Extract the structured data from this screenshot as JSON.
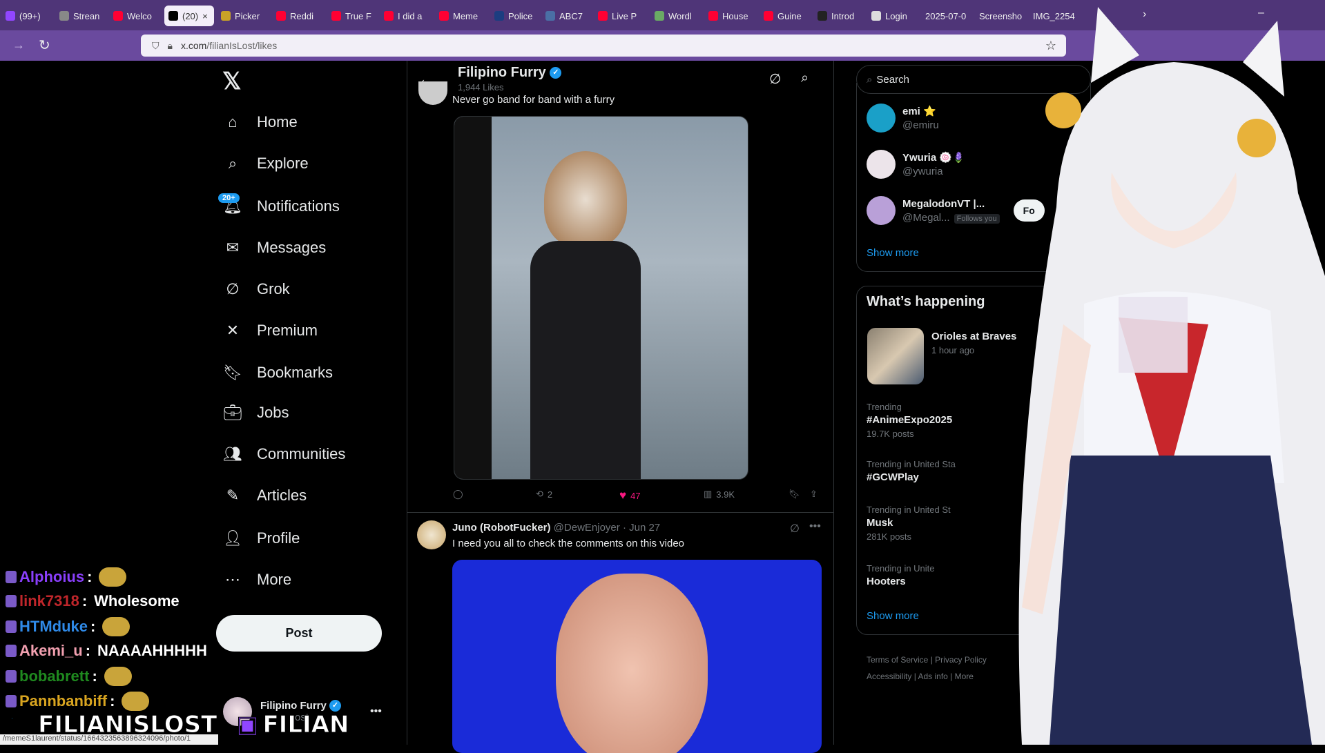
{
  "browser": {
    "tabs": [
      {
        "label": "(99+)",
        "color": "#9146ff"
      },
      {
        "label": "Strean",
        "color": "#888"
      },
      {
        "label": "Welco",
        "color": "#ff0033"
      },
      {
        "label": "(20)",
        "color": "#000",
        "active": true
      },
      {
        "label": "Picker",
        "color": "#c9a227"
      },
      {
        "label": "Reddi",
        "color": "#ff0033"
      },
      {
        "label": "True F",
        "color": "#ff0033"
      },
      {
        "label": "I did a",
        "color": "#ff0033"
      },
      {
        "label": "Meme",
        "color": "#ff0033"
      },
      {
        "label": "Police",
        "color": "#1c3d80"
      },
      {
        "label": "ABC7",
        "color": "#4a6fa5"
      },
      {
        "label": "Live P",
        "color": "#ff0033"
      },
      {
        "label": "Wordl",
        "color": "#6aaa64"
      },
      {
        "label": "House",
        "color": "#ff0033"
      },
      {
        "label": "Guine",
        "color": "#ff0033"
      },
      {
        "label": "Introd",
        "color": "#222"
      },
      {
        "label": "Login",
        "color": "#ddd"
      },
      {
        "label": "2025-07-0",
        "color": ""
      },
      {
        "label": "Screensho",
        "color": ""
      },
      {
        "label": "IMG_2254",
        "color": ""
      }
    ],
    "close": "×",
    "url_domain": "x.com",
    "url_path": "/filianIsLost/likes",
    "status_url": "/memeS1laurent/status/1664323563896324096/photo/1"
  },
  "nav": {
    "items": [
      {
        "label": "Home",
        "icon": "home-icon"
      },
      {
        "label": "Explore",
        "icon": "search-icon"
      },
      {
        "label": "Notifications",
        "icon": "bell-icon"
      },
      {
        "label": "Messages",
        "icon": "mail-icon"
      },
      {
        "label": "Grok",
        "icon": "grok-icon"
      },
      {
        "label": "Premium",
        "icon": "x-icon"
      },
      {
        "label": "Bookmarks",
        "icon": "bookmark-icon"
      },
      {
        "label": "Jobs",
        "icon": "briefcase-icon"
      },
      {
        "label": "Communities",
        "icon": "communities-icon"
      },
      {
        "label": "Articles",
        "icon": "articles-icon"
      },
      {
        "label": "Profile",
        "icon": "person-icon"
      },
      {
        "label": "More",
        "icon": "more-circle-icon"
      }
    ],
    "notif_badge": "20+",
    "post": "Post",
    "account_name": "Filipino Furry",
    "account_sub": "ost"
  },
  "header": {
    "title": "Filipino Furry",
    "count": "1,944 Likes"
  },
  "tweet1": {
    "text": "Never go band for band with a furry",
    "replies": "",
    "retweets": "2",
    "likes": "47",
    "views": "3.9K"
  },
  "tweet2": {
    "name": "Juno (RobotFucker)",
    "handle": "@DewEnjoyer",
    "date": "· Jun 27",
    "text": "I need you all to check the comments on this video"
  },
  "right": {
    "search": "Search",
    "follow": [
      {
        "name": "emi ⭐",
        "handle": "@emiru",
        "tag": ""
      },
      {
        "name": "Ywuria 🍥🪻",
        "handle": "@ywuria",
        "tag": ""
      },
      {
        "name": "MegalodonVT |...",
        "handle": "@Megal...",
        "tag": "Follows you"
      }
    ],
    "follow_btn": "Fo",
    "show_more": "Show more",
    "happening_title": "What’s happening",
    "event": {
      "title": "Orioles at Braves",
      "time": "1 hour ago"
    },
    "trends": [
      {
        "ctx": "Trending",
        "name": "#AnimeExpo2025",
        "posts": "19.7K posts"
      },
      {
        "ctx": "Trending in United Sta",
        "name": "#GCWPlay",
        "posts": ""
      },
      {
        "ctx": "Trending in United St",
        "name": "Musk",
        "posts": "281K posts"
      },
      {
        "ctx": "Trending in Unite",
        "name": "Hooters",
        "posts": ""
      }
    ],
    "footer": [
      "Terms of Service",
      "Privacy Policy",
      "Accessibility",
      "Ads info",
      "More"
    ]
  },
  "chat": [
    {
      "user": "Alphoius",
      "color": "#8a3ffc",
      "msg": ""
    },
    {
      "user": "link7318",
      "color": "#c0262b",
      "msg": "Wholesome"
    },
    {
      "user": "HTMduke",
      "color": "#2f8ae8",
      "msg": ""
    },
    {
      "user": "Akemi_u",
      "color": "#f2a0b0",
      "msg": "NAAAAHHHHH"
    },
    {
      "user": "bobabrett",
      "color": "#1f8a1f",
      "msg": ""
    },
    {
      "user": "Pannbanbiff",
      "color": "#d9a520",
      "msg": ""
    }
  ],
  "overlay": {
    "twitter": "FILIANISLOST",
    "twitch": "FILIAN"
  }
}
